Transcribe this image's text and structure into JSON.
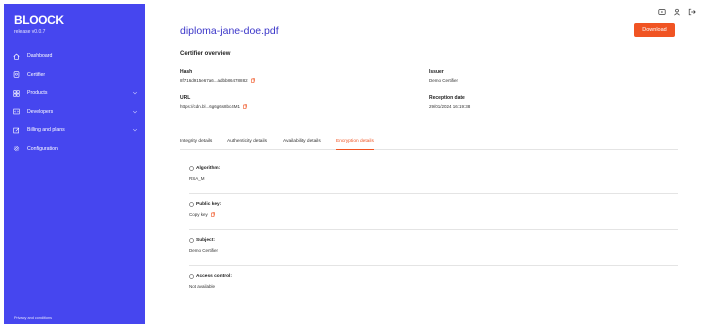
{
  "sidebar": {
    "brand": "BLOOCK",
    "version": "release v0.0.7",
    "items": [
      {
        "label": "Dashboard",
        "icon": "home-icon",
        "expandable": false
      },
      {
        "label": "Certifier",
        "icon": "certificate-icon",
        "expandable": false
      },
      {
        "label": "Products",
        "icon": "products-icon",
        "expandable": true
      },
      {
        "label": "Developers",
        "icon": "code-icon",
        "expandable": true
      },
      {
        "label": "Billing and plans",
        "icon": "billing-icon",
        "expandable": true
      },
      {
        "label": "Configuration",
        "icon": "gear-icon",
        "expandable": false
      }
    ],
    "footer_link": "Privacy and conditions"
  },
  "header": {
    "filename": "diploma-jane-doe.pdf",
    "download_label": "Download",
    "icons": [
      "screen-icon",
      "user-icon",
      "logout-icon"
    ]
  },
  "overview": {
    "title": "Certifier overview",
    "hash_label": "Hash",
    "hash_value": "8f716d915e67a6...adbb86478882",
    "url_label": "URL",
    "url_value": "https://cdn.bl...6g6g6s8bc4M1",
    "issuer_label": "Issuer",
    "issuer_value": "Demo Certifier",
    "reception_label": "Reception date",
    "reception_value": "29/01/2024 16:19:38"
  },
  "tabs": [
    {
      "label": "Integrity details",
      "active": false
    },
    {
      "label": "Authenticity details",
      "active": false
    },
    {
      "label": "Availability details",
      "active": false
    },
    {
      "label": "Encryption details",
      "active": true
    }
  ],
  "encryption": {
    "algorithm_label": "Algorithm:",
    "algorithm_value": "RSA_M",
    "public_key_label": "Public key:",
    "public_key_value": "Copy key",
    "subject_label": "Subject:",
    "subject_value": "Demo Certifier",
    "access_control_label": "Access control:",
    "access_control_value": "Not available"
  },
  "colors": {
    "sidebar": "#4646ef",
    "accent": "#f05423",
    "filename": "#3b36c9"
  }
}
